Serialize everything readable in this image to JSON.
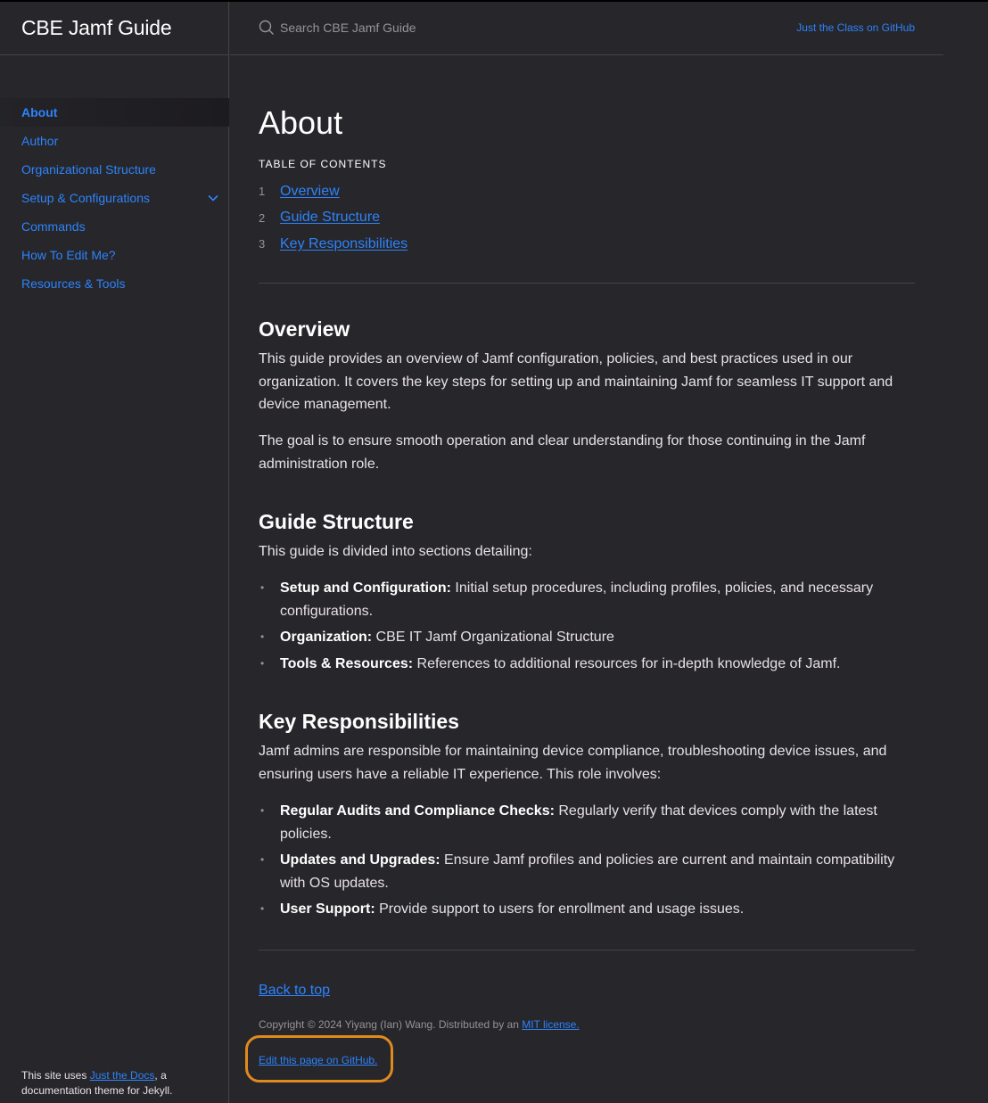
{
  "site": {
    "title": "CBE Jamf Guide"
  },
  "header": {
    "search_placeholder": "Search CBE Jamf Guide",
    "aux_link": "Just the Class on GitHub"
  },
  "sidebar": {
    "items": [
      {
        "label": "About",
        "active": true
      },
      {
        "label": "Author"
      },
      {
        "label": "Organizational Structure"
      },
      {
        "label": "Setup & Configurations",
        "expandable": true
      },
      {
        "label": "Commands"
      },
      {
        "label": "How To Edit Me?"
      },
      {
        "label": "Resources & Tools"
      }
    ],
    "footer": {
      "prefix": "This site uses ",
      "link": "Just the Docs",
      "suffix": ", a documentation theme for Jekyll."
    }
  },
  "page": {
    "title": "About",
    "toc_heading": "TABLE OF CONTENTS",
    "toc": [
      {
        "num": "1",
        "label": "Overview"
      },
      {
        "num": "2",
        "label": "Guide Structure"
      },
      {
        "num": "3",
        "label": "Key Responsibilities"
      }
    ],
    "overview": {
      "heading": "Overview",
      "p1": "This guide provides an overview of Jamf configuration, policies, and best practices used in our organization. It covers the key steps for setting up and maintaining Jamf for seamless IT support and device management.",
      "p2": "The goal is to ensure smooth operation and clear understanding for those continuing in the Jamf administration role."
    },
    "guide_structure": {
      "heading": "Guide Structure",
      "intro": "This guide is divided into sections detailing:",
      "items": [
        {
          "bold": "Setup and Configuration:",
          "text": " Initial setup procedures, including profiles, policies, and necessary configurations."
        },
        {
          "bold": "Organization:",
          "text": " CBE IT Jamf Organizational Structure"
        },
        {
          "bold": "Tools & Resources:",
          "text": " References to additional resources for in-depth knowledge of Jamf."
        }
      ]
    },
    "key_responsibilities": {
      "heading": "Key Responsibilities",
      "intro": "Jamf admins are responsible for maintaining device compliance, troubleshooting device issues, and ensuring users have a reliable IT experience. This role involves:",
      "items": [
        {
          "bold": "Regular Audits and Compliance Checks:",
          "text": " Regularly verify that devices comply with the latest policies."
        },
        {
          "bold": "Updates and Upgrades:",
          "text": " Ensure Jamf profiles and policies are current and maintain compatibility with OS updates."
        },
        {
          "bold": "User Support:",
          "text": " Provide support to users for enrollment and usage issues."
        }
      ]
    },
    "footer": {
      "back_to_top": "Back to top",
      "copyright_text": "Copyright © 2024 Yiyang (Ian) Wang. Distributed by an ",
      "license_link": "MIT license.",
      "edit_link": "Edit this page on GitHub."
    }
  },
  "colors": {
    "background": "#27262b",
    "link": "#2c84fa",
    "highlight": "#e08a1e"
  }
}
